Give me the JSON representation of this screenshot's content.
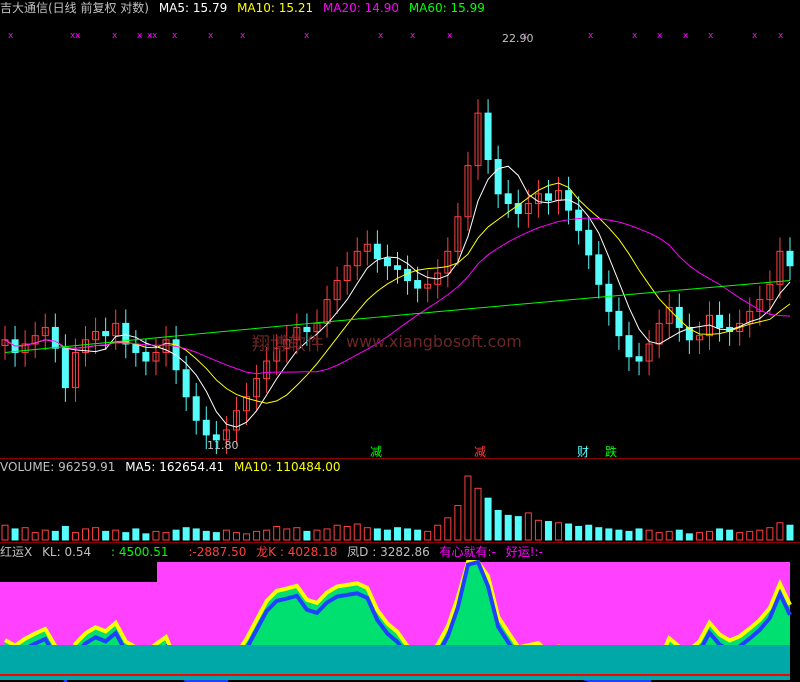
{
  "header_main": {
    "title": "吉大通信(日线 前复权 对数)",
    "ma5": "MA5: 15.79",
    "ma10": "MA10: 15.21",
    "ma20": "MA20: 14.90",
    "ma60": "MA60: 15.99"
  },
  "header_volume": {
    "volume": "VOLUME: 96259.91",
    "ma5": "MA5: 162654.41",
    "ma10": "MA10: 110484.00"
  },
  "header_indicator": {
    "name": "红运X",
    "kl": "KL: 0.54",
    "v1": ": 4500.51",
    "v2": ":-2887.50",
    "longk": "龙K : 4028.18",
    "feng": "凤D : 3282.86",
    "text1": "有心就有:-",
    "text2": "好运!:-"
  },
  "watermark": {
    "cn": "翔博软件",
    "url": "www.xiangbosoft.com"
  },
  "chart_data": [
    {
      "type": "candlestick",
      "annotations": {
        "high": "22.90",
        "low": "11.80"
      },
      "event_labels": [
        "减",
        "减",
        "财",
        "跌"
      ],
      "series_names": [
        "MA5",
        "MA10",
        "MA20",
        "MA60"
      ],
      "colors": {
        "up": "#ff4040",
        "down": "#54fcfc",
        "ma5": "#ffffff",
        "ma10": "#ffff00",
        "ma20": "#ff00ff",
        "ma60": "#00ff00"
      },
      "close": [
        13.5,
        13.2,
        13.4,
        13.6,
        13.8,
        13.3,
        12.4,
        13.2,
        13.5,
        13.7,
        13.6,
        13.9,
        13.4,
        13.2,
        13.0,
        13.2,
        13.5,
        12.8,
        12.2,
        11.7,
        11.4,
        11.3,
        11.5,
        11.9,
        12.2,
        12.6,
        13.0,
        13.3,
        13.5,
        13.8,
        13.7,
        13.9,
        14.5,
        15.0,
        15.4,
        15.8,
        16.0,
        15.6,
        15.4,
        15.3,
        15.0,
        14.8,
        14.9,
        15.2,
        15.8,
        16.8,
        18.4,
        20.2,
        18.6,
        17.5,
        17.2,
        16.9,
        17.2,
        17.5,
        17.3,
        17.6,
        17.0,
        16.4,
        15.7,
        14.9,
        14.2,
        13.6,
        13.1,
        13.0,
        13.4,
        13.9,
        14.3,
        13.8,
        13.5,
        13.6,
        14.1,
        13.8,
        13.7,
        13.9,
        14.2,
        14.5,
        14.9,
        15.8,
        15.4
      ],
      "ma60_level": [
        13.2,
        15.0
      ]
    },
    {
      "type": "bar",
      "name": "VOLUME",
      "values": [
        60,
        45,
        50,
        30,
        40,
        35,
        55,
        30,
        45,
        50,
        35,
        40,
        30,
        45,
        25,
        35,
        30,
        40,
        50,
        45,
        35,
        30,
        40,
        30,
        25,
        35,
        40,
        55,
        45,
        50,
        35,
        40,
        45,
        60,
        55,
        65,
        50,
        45,
        40,
        50,
        45,
        40,
        35,
        60,
        90,
        140,
        260,
        210,
        170,
        120,
        100,
        95,
        110,
        80,
        75,
        70,
        65,
        55,
        60,
        50,
        45,
        40,
        35,
        45,
        40,
        30,
        35,
        40,
        25,
        30,
        35,
        45,
        40,
        30,
        35,
        40,
        50,
        70,
        60
      ]
    },
    {
      "type": "area",
      "name": "红运X",
      "series_names": [
        "龙K",
        "凤D"
      ]
    }
  ]
}
